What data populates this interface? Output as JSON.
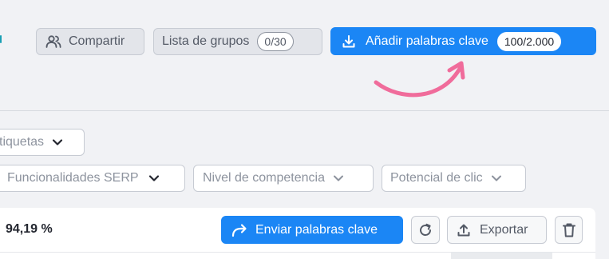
{
  "header": {
    "share_label": "Compartir",
    "groups_label": "Lista de grupos",
    "groups_count": "0/30",
    "add_keywords_label": "Añadir palabras clave",
    "add_keywords_count": "100/2.000"
  },
  "filters": {
    "tags_label": "tiquetas",
    "serp_label": "Funcionalidades SERP",
    "competition_label": "Nivel de competencia",
    "click_potential_label": "Potencial de clic"
  },
  "toolbar": {
    "percentage": "94,19 %",
    "send_keywords_label": "Enviar palabras clave",
    "export_label": "Exportar"
  },
  "colors": {
    "primary": "#1b86f5",
    "annotation_arrow": "#f06c9b",
    "background": "#f1f2f5"
  },
  "icons": {
    "share": "users-icon",
    "add_keywords": "download-icon",
    "send": "share-arrow-icon",
    "refresh": "refresh-icon",
    "export": "upload-icon",
    "delete": "trash-icon",
    "dropdown": "chevron-down-icon"
  }
}
